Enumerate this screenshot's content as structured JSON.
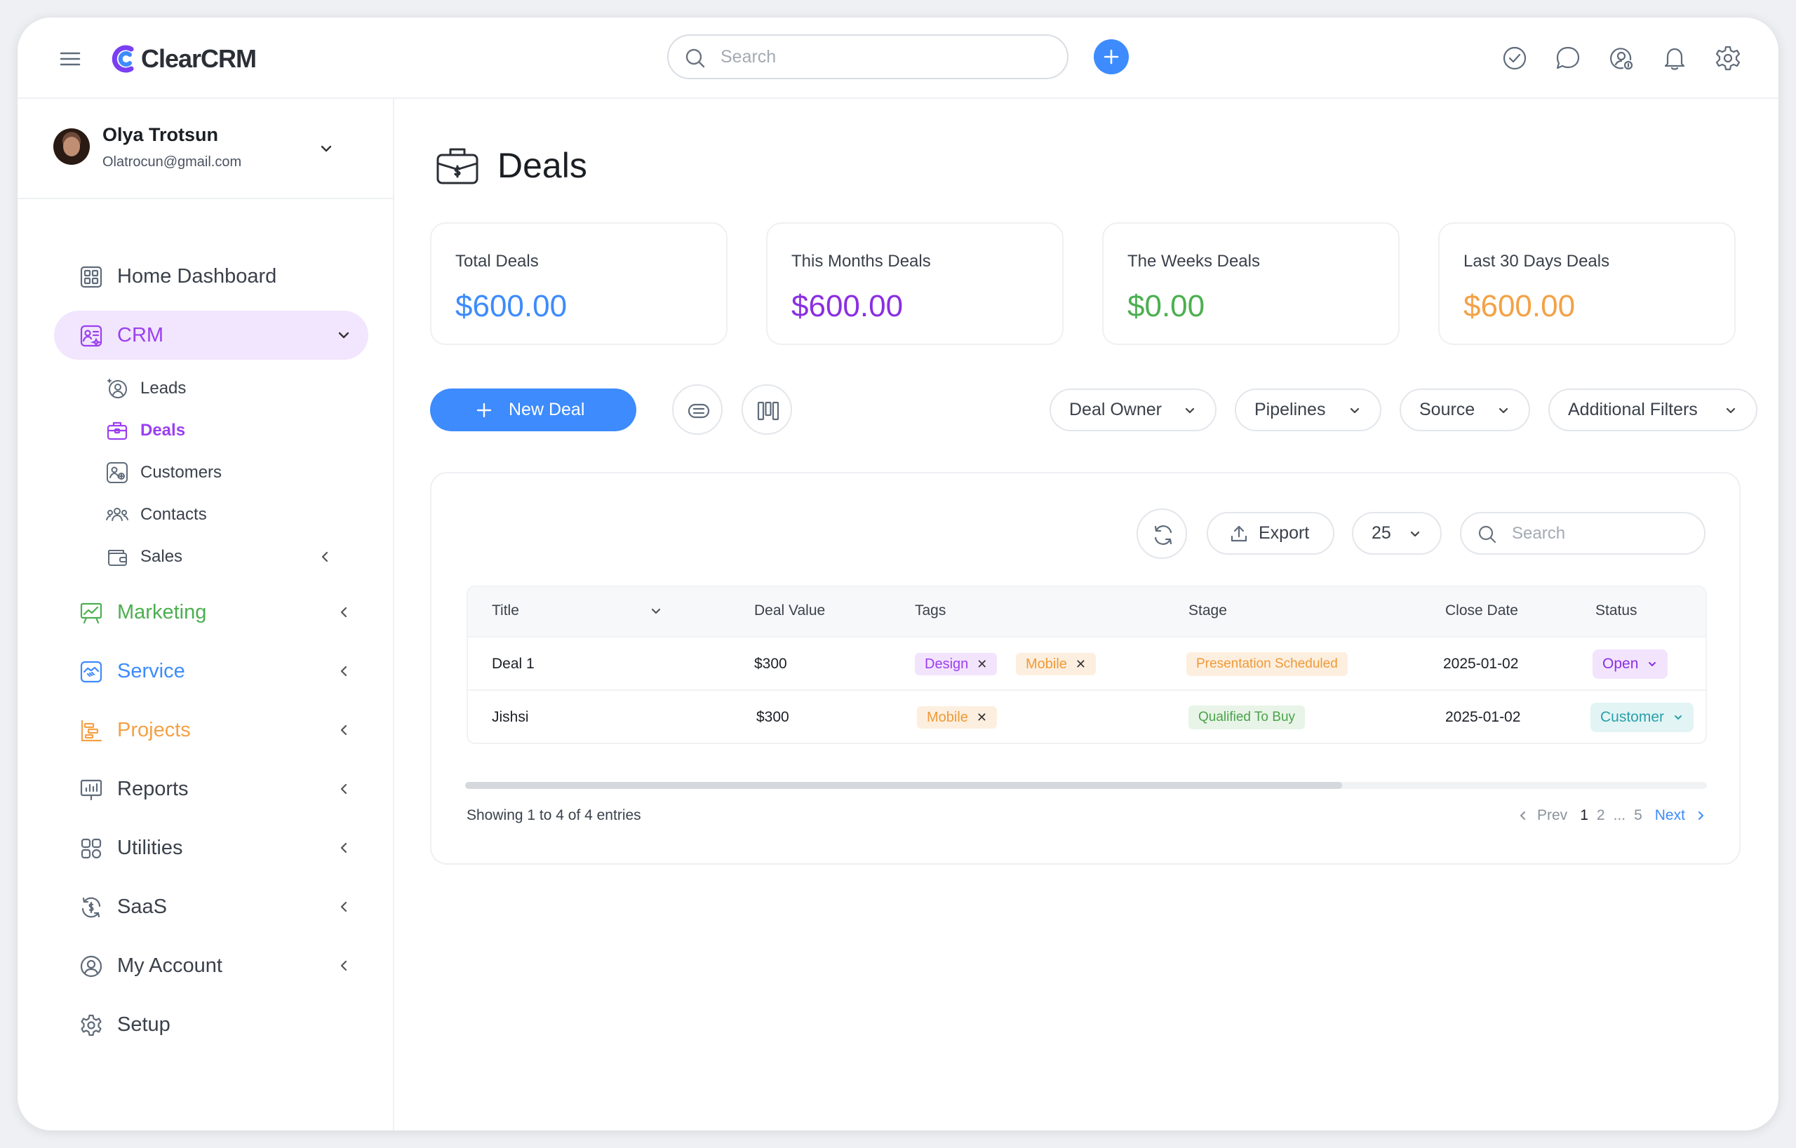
{
  "app": {
    "logo_text": "ClearCRM",
    "search_placeholder": "Search"
  },
  "colors": {
    "accent_blue": "#3d8bfd",
    "crm_purple": "#9b3ff0",
    "marketing_green": "#4caf50",
    "service_blue": "#3d8bfd",
    "projects_orange": "#f4a146"
  },
  "user": {
    "name": "Olya Trotsun",
    "email": "Olatrocun@gmail.com"
  },
  "nav": {
    "home": "Home Dashboard",
    "crm": "CRM",
    "crm_sub": {
      "leads": "Leads",
      "deals": "Deals",
      "customers": "Customers",
      "contacts": "Contacts",
      "sales": "Sales"
    },
    "marketing": "Marketing",
    "service": "Service",
    "projects": "Projects",
    "reports": "Reports",
    "utilities": "Utilities",
    "saas": "SaaS",
    "my_account": "My Account",
    "setup": "Setup"
  },
  "page": {
    "title": "Deals"
  },
  "stats": [
    {
      "label": "Total Deals",
      "value": "$600.00",
      "color": "#3d8bfd"
    },
    {
      "label": "This Months Deals",
      "value": "$600.00",
      "color": "#8a2fe2"
    },
    {
      "label": "The Weeks Deals",
      "value": "$0.00",
      "color": "#4caf50"
    },
    {
      "label": "Last 30 Days Deals",
      "value": "$600.00",
      "color": "#f4a146"
    }
  ],
  "toolbar": {
    "new_deal": "New Deal",
    "filters": {
      "deal_owner": "Deal Owner",
      "pipelines": "Pipelines",
      "source": "Source",
      "additional": "Additional Filters"
    }
  },
  "table": {
    "export_label": "Export",
    "per_page": "25",
    "search_placeholder": "Search",
    "columns": {
      "title": "Title",
      "deal_value": "Deal Value",
      "tags": "Tags",
      "stage": "Stage",
      "close_date": "Close Date",
      "status": "Status"
    },
    "rows": [
      {
        "title": "Deal 1",
        "deal_value": "$300",
        "tags": [
          "Design",
          "Mobile"
        ],
        "stage": "Presentation Scheduled",
        "close_date": "2025-01-02",
        "status": "Open"
      },
      {
        "title": "Jishsi",
        "deal_value": "$300",
        "tags": [
          "Mobile"
        ],
        "stage": "Qualified To Buy",
        "close_date": "2025-01-02",
        "status": "Customer"
      }
    ],
    "horizontal_scroll_position": 0.0,
    "showing_text": "Showing 1 to 4 of 4 entries",
    "pager": {
      "prev": "Prev",
      "pages": [
        "1",
        "2",
        "...",
        "5"
      ],
      "next": "Next"
    }
  }
}
